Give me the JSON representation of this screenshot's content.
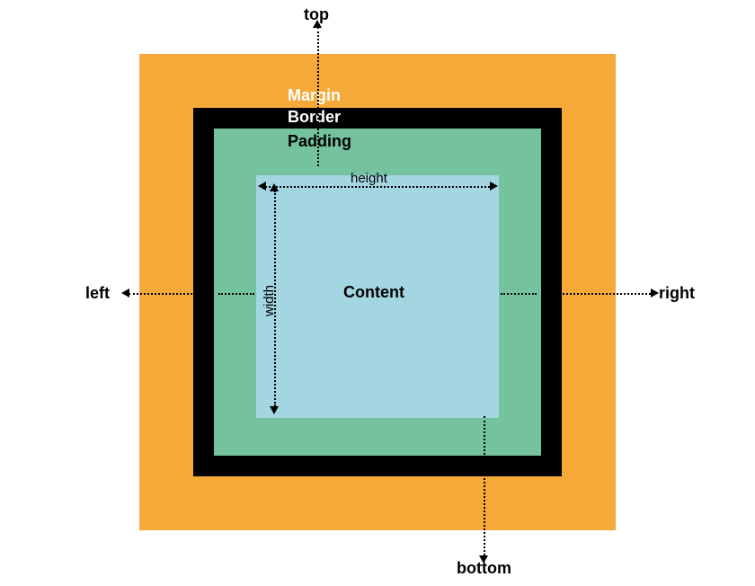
{
  "labels": {
    "margin": "Margin",
    "border": "Border",
    "padding": "Padding",
    "content": "Content",
    "top": "top",
    "bottom": "bottom",
    "left": "left",
    "right": "right",
    "height": "height",
    "width": "width"
  },
  "colors": {
    "margin": "#f5a938",
    "border": "#000000",
    "padding": "#75c29e",
    "content": "#a4d6e2",
    "background": "#ffffff"
  }
}
